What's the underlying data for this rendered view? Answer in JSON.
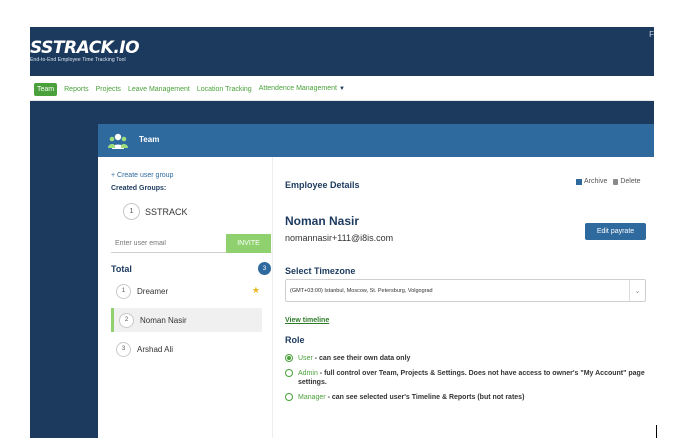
{
  "header": {
    "logo": "SSTRACK.IO",
    "tagline": "End-to-End Employee Time Tracking Tool",
    "corner_mark": "F"
  },
  "nav": {
    "items": [
      "Team",
      "Reports",
      "Projects",
      "Leave Management",
      "Location Tracking"
    ],
    "more_label": "Attendence Management"
  },
  "panel": {
    "title": "Team"
  },
  "groups": {
    "create_link": "+ Create user group",
    "created_label": "Created Groups:",
    "items": [
      {
        "num": "1",
        "name": "SSTRACK"
      }
    ]
  },
  "invite": {
    "placeholder": "Enter user email",
    "button": "INVITE"
  },
  "members": {
    "total_label": "Total",
    "count": "3",
    "items": [
      {
        "num": "1",
        "name": "Dreamer"
      },
      {
        "num": "2",
        "name": "Noman Nasir"
      },
      {
        "num": "3",
        "name": "Arshad Ali"
      }
    ]
  },
  "details": {
    "heading": "Employee Details",
    "archive": "Archive",
    "delete": "Delete",
    "name": "Noman Nasir",
    "email": "nomannasir+111@i8is.com",
    "edit_payrate": "Edit payrate",
    "timezone_heading": "Select Timezone",
    "timezone_value": "(GMT+03:00) Istanbul, Moscow, St. Petersburg, Volgograd",
    "view_timeline": "View timeline",
    "role_heading": "Role",
    "roles": [
      {
        "name": "User",
        "desc": " - can see their own data only",
        "selected": true
      },
      {
        "name": "Admin",
        "desc": " - full control over Team, Projects & Settings. Does not have access to owner's \"My Account\" page settings.",
        "selected": false
      },
      {
        "name": "Manager",
        "desc": " - can see selected user's Timeline & Reports (but not rates)",
        "selected": false
      }
    ]
  },
  "colors": {
    "navy": "#1c3a5e",
    "panel_blue": "#2e6a9e",
    "green": "#4aa03a",
    "invite_green": "#8fd16e",
    "star": "#e8b824"
  }
}
